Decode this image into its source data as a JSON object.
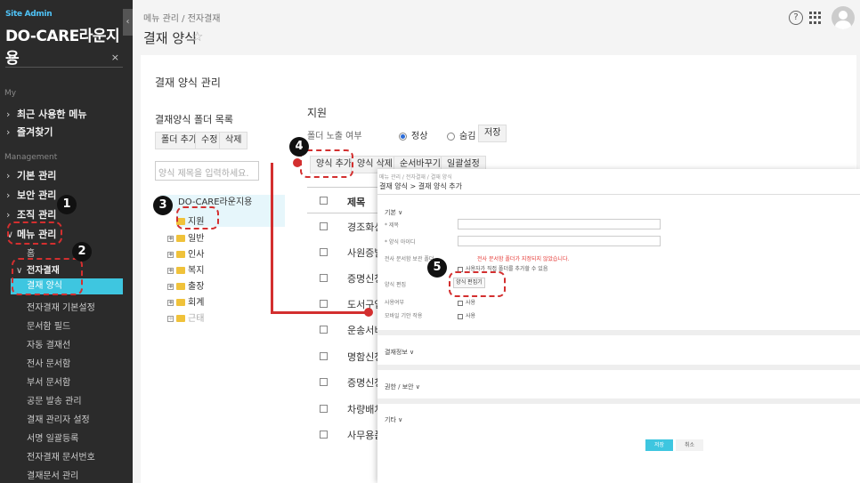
{
  "sidebar": {
    "site_label": "Site Admin",
    "brand": "DO-CARE라운지용",
    "collapse": "‹",
    "search_icon": "⌕",
    "clear_icon": "×",
    "sections": {
      "my": "My",
      "management": "Management"
    },
    "my_items": [
      "최근 사용한 메뉴",
      "즐겨찾기"
    ],
    "mgmt_items": [
      "기본 관리",
      "보안 관리",
      "조직 관리",
      "메뉴 관리"
    ],
    "menu_sub_home": "홈",
    "menu_sub_approval": "전자결재",
    "approval_items": [
      "결재 양식",
      "전자결재 기본설정",
      "문서함 필드",
      "자동 결재선",
      "전사 문서함",
      "부서 문서함",
      "공문 발송 관리",
      "결재 관리자 설정",
      "서명 일괄등록",
      "전자결재 문서번호",
      "결재문서 관리"
    ]
  },
  "header": {
    "breadcrumb": "메뉴 관리 / 전자결재",
    "title": "결재 양식",
    "star": "☆",
    "help": "?"
  },
  "panel": {
    "title": "결재 양식 관리",
    "folder_title": "결재양식 폴더 목록",
    "folder_buttons": [
      "폴더 추가",
      "수정",
      "삭제"
    ],
    "folder_search_placeholder": "양식 제목을 입력하세요.",
    "tree_root": "DO-CARE라운지용",
    "tree_children": [
      "지원",
      "일반",
      "인사",
      "복지",
      "출장",
      "회계",
      "근태"
    ],
    "right_title": "지원",
    "expose_label": "폴더 노출 여부",
    "radio_normal": "정상",
    "radio_hidden": "숨김",
    "save": "저장",
    "form_buttons": [
      "양식 추가",
      "양식 삭제",
      "순서바꾸기",
      "일괄설정"
    ],
    "col_title": "제목",
    "rows": [
      "경조화신",
      "사원증발",
      "증명신청",
      "도서구입",
      "운송서비",
      "명함신청",
      "증명신청",
      "차량배차",
      "사무용품"
    ]
  },
  "popup": {
    "crumb": "메뉴 관리 / 전자결재 / 결재 양식",
    "title": "결재 양식 > 결재 양식 추가",
    "sec_basic": "기본 ∨",
    "label_title": "* 제목",
    "label_form_id": "* 양식 아이디",
    "label_folder": "전사 문서함 보관 폴더",
    "red_notice": "전사 문서함 폴더가 지정되지 않았습니다.",
    "check_user_folder": "사용자가 직접 폴더를 추가할 수 있음",
    "label_form_edit": "양식 편집",
    "btn_form_edit": "양식 편집기",
    "label_use": "사용여부",
    "check_use": "사용",
    "label_mobile": "모바일 기안 작용",
    "check_mobile": "사용",
    "sec_approval_info": "결재정보 ∨",
    "sec_rights": "권한 / 보안 ∨",
    "sec_etc": "기타 ∨",
    "save": "저장",
    "cancel": "취소"
  },
  "steps": [
    "1",
    "2",
    "3",
    "4",
    "5"
  ],
  "colors": {
    "accent": "#3ec6e0",
    "annotation": "#d32f2f",
    "sidebar": "#2b2b2b"
  }
}
